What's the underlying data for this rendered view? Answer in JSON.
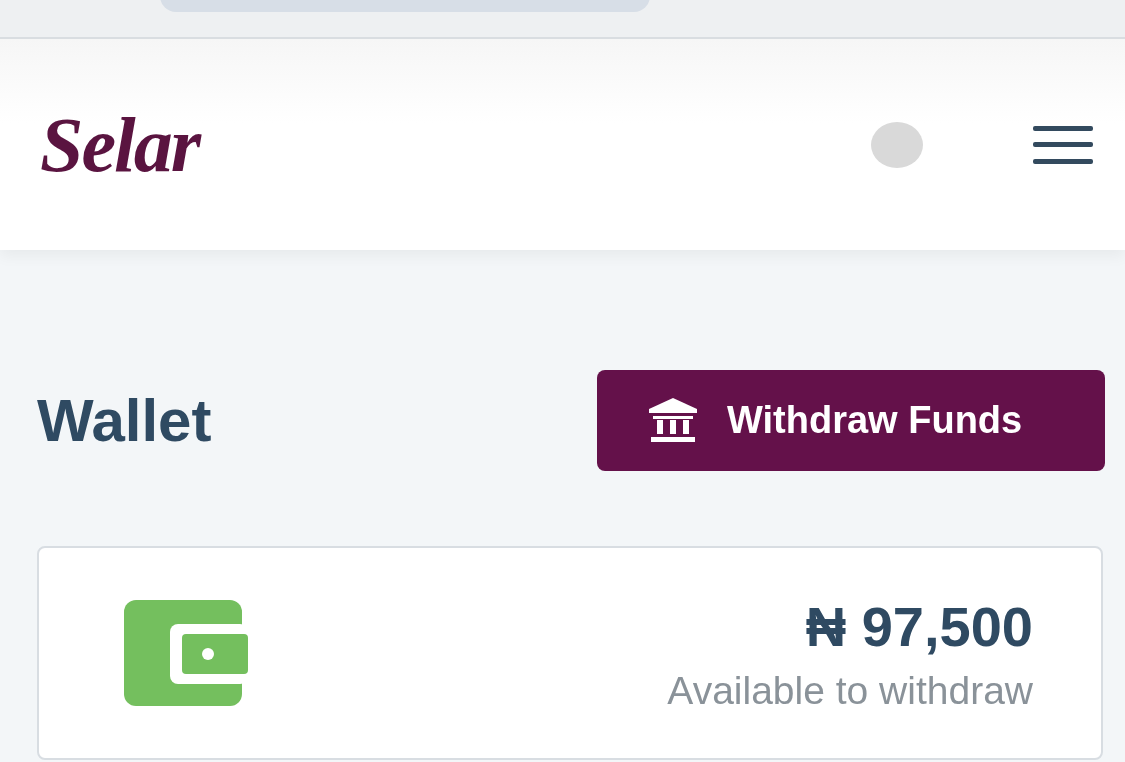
{
  "header": {
    "logo": "Selar"
  },
  "page": {
    "title": "Wallet",
    "action_button": "Withdraw Funds"
  },
  "balance_card": {
    "amount": "₦ 97,500",
    "caption": "Available to withdraw"
  }
}
